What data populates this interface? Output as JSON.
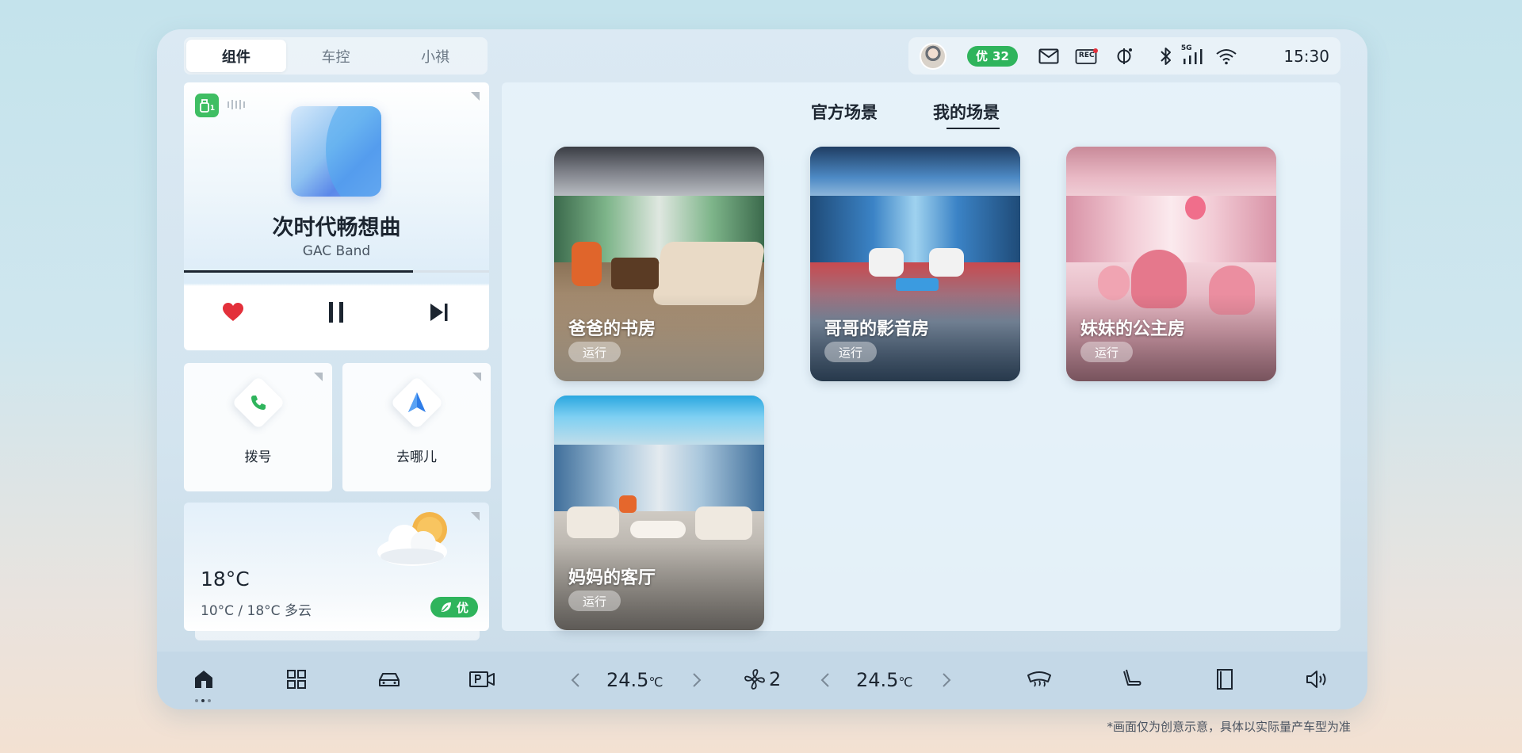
{
  "tabs": [
    "组件",
    "车控",
    "小祺"
  ],
  "status": {
    "badge_icon": "优",
    "badge_value": "32",
    "rec_label": "REC",
    "network_label": "5G",
    "time": "15:30"
  },
  "music": {
    "app_badge": "1",
    "song": "次时代畅想曲",
    "artist": "GAC Band",
    "progress": 0.75
  },
  "quick": {
    "dial_label": "拨号",
    "nav_label": "去哪儿"
  },
  "weather": {
    "temp": "18°C",
    "range": "10°C / 18°C  多云",
    "aqi_label": "优"
  },
  "scene_tabs": [
    "官方场景",
    "我的场景"
  ],
  "scenes": [
    {
      "title": "爸爸的书房",
      "run": "运行"
    },
    {
      "title": "哥哥的影音房",
      "run": "运行"
    },
    {
      "title": "妹妹的公主房",
      "run": "运行"
    },
    {
      "title": "妈妈的客厅",
      "run": "运行"
    }
  ],
  "dock": {
    "temp_left": "24.5",
    "temp_right": "24.5",
    "temp_unit": "℃",
    "fan_level": "2"
  },
  "disclaimer": "*画面仅为创意示意，具体以实际量产车型为准",
  "colors": {
    "accent_green": "#2fb45c",
    "heart_red": "#e3303b",
    "nav_blue": "#2f7de8",
    "phone_green": "#2fb45c"
  }
}
